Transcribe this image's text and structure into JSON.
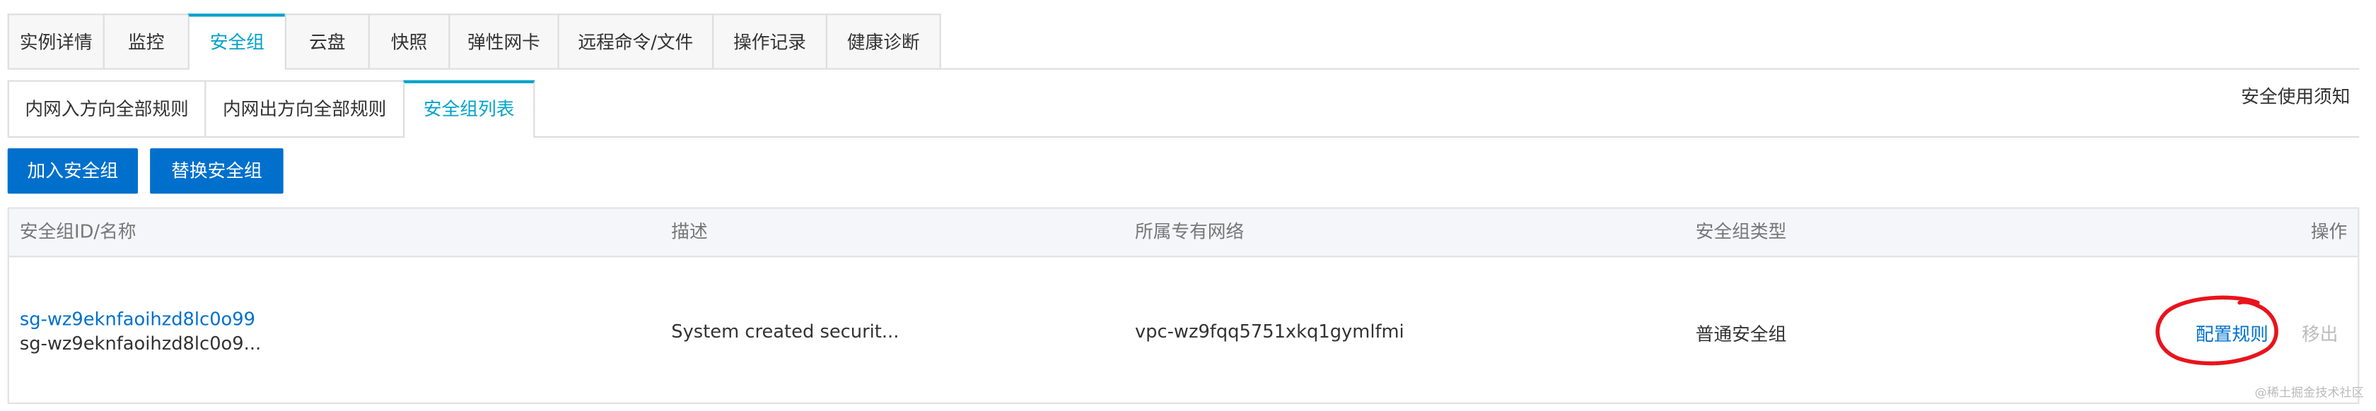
{
  "top_tabs": [
    {
      "label": "实例详情",
      "active": false
    },
    {
      "label": "监控",
      "active": false
    },
    {
      "label": "安全组",
      "active": true
    },
    {
      "label": "云盘",
      "active": false
    },
    {
      "label": "快照",
      "active": false
    },
    {
      "label": "弹性网卡",
      "active": false
    },
    {
      "label": "远程命令/文件",
      "active": false
    },
    {
      "label": "操作记录",
      "active": false
    },
    {
      "label": "健康诊断",
      "active": false
    }
  ],
  "sub_tabs": [
    {
      "label": "内网入方向全部规则",
      "active": false
    },
    {
      "label": "内网出方向全部规则",
      "active": false
    },
    {
      "label": "安全组列表",
      "active": true
    }
  ],
  "notice_link": "安全使用须知",
  "buttons": {
    "join": "加入安全组",
    "replace": "替换安全组"
  },
  "table": {
    "headers": {
      "id_name": "安全组ID/名称",
      "description": "描述",
      "vpc": "所属专有网络",
      "type": "安全组类型",
      "actions": "操作"
    },
    "rows": [
      {
        "id": "sg-wz9eknfaoihzd8lc0o99",
        "name": "sg-wz9eknfaoihzd8lc0o9...",
        "description": "System created securit...",
        "vpc": "vpc-wz9fqq5751xkq1gymlfmi",
        "type": "普通安全组",
        "action_config": "配置规则",
        "action_remove": "移出"
      }
    ]
  },
  "annotation_color": "#e8141c",
  "accent_color": "#0070cc",
  "watermark": "@稀土掘金技术社区"
}
